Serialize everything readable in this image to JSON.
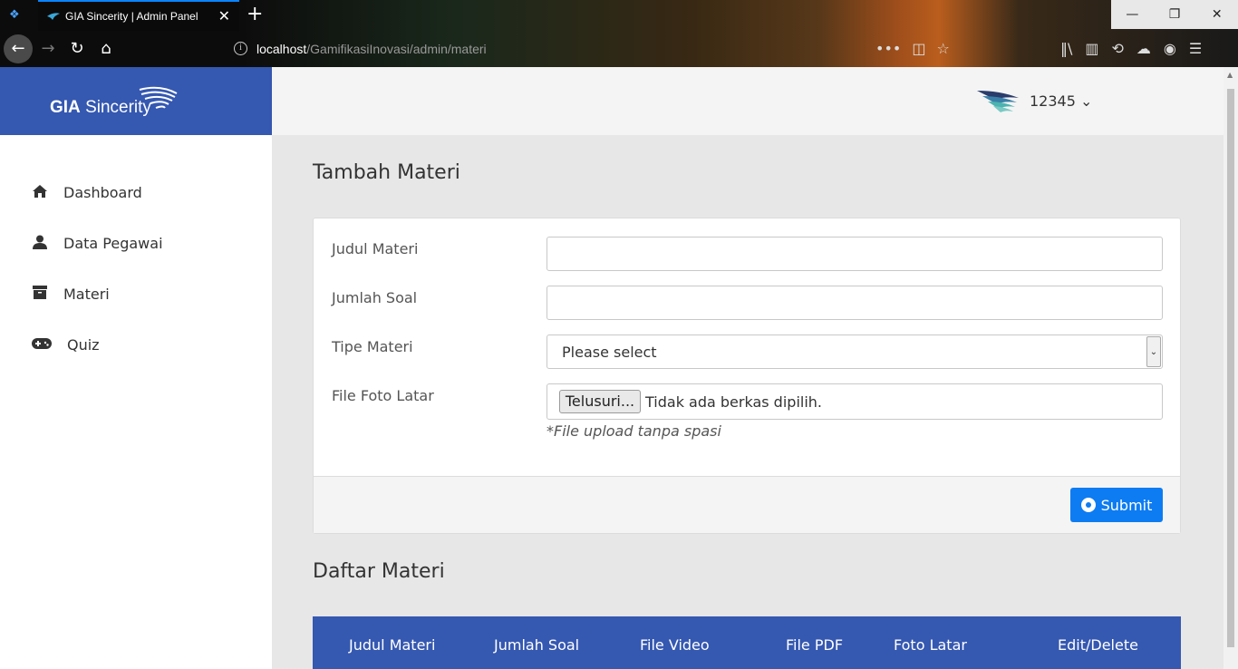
{
  "browser": {
    "tab_title": "GIA Sincerity | Admin Panel",
    "url_host": "localhost",
    "url_path": "/GamifikasiInovasi/admin/materi",
    "new_tab": "+",
    "tab_close": "✕"
  },
  "brand": {
    "name_bold": "GIA",
    "name_rest": "Sincerity"
  },
  "header": {
    "user_label": "12345 ⌄"
  },
  "sidebar": {
    "items": [
      {
        "label": "Dashboard",
        "icon": "home-icon"
      },
      {
        "label": "Data Pegawai",
        "icon": "user-icon"
      },
      {
        "label": "Materi",
        "icon": "archive-icon"
      },
      {
        "label": "Quiz",
        "icon": "gamepad-icon"
      }
    ]
  },
  "form": {
    "title": "Tambah Materi",
    "judul_label": "Judul Materi",
    "judul_value": "",
    "jumlah_label": "Jumlah Soal",
    "jumlah_value": "",
    "tipe_label": "Tipe Materi",
    "tipe_value": "Please select",
    "file_label": "File Foto Latar",
    "file_button": "Telusuri...",
    "file_status": "Tidak ada berkas dipilih.",
    "file_hint": "*File upload tanpa spasi",
    "submit_label": "Submit"
  },
  "list": {
    "title": "Daftar Materi",
    "columns": [
      "Judul Materi",
      "Jumlah Soal",
      "File Video",
      "File PDF",
      "Foto Latar",
      "Edit/Delete"
    ]
  },
  "colors": {
    "brand": "#3558b1",
    "accent": "#0d7cf2",
    "main_bg": "#e7e7e7"
  }
}
